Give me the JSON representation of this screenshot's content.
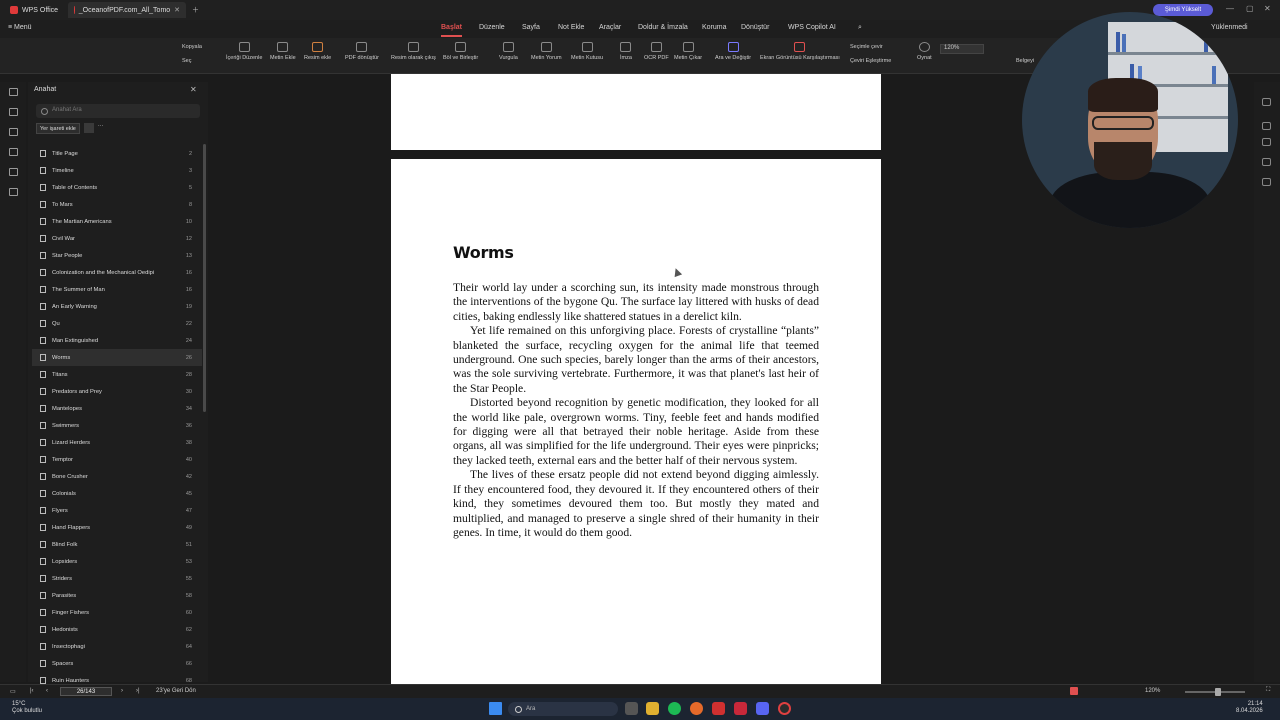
{
  "titlebar": {
    "app_tab": "WPS Office",
    "doc_tab": "_OceanofPDF.com_All_Tomo",
    "upgrade_label": "Şimdi Yükselt"
  },
  "menubar": {
    "menu_label": "Menü",
    "tabs": [
      "Başlat",
      "Düzenle",
      "Sayfa",
      "Not Ekle",
      "Araçlar",
      "Doldur & İmzala",
      "Koruma",
      "Dönüştür",
      "WPS Copilot AI"
    ],
    "active_tab": "Başlat",
    "uploaded_label": "Yüklenmedi"
  },
  "ribbon": {
    "copy": "Kopyala",
    "select": "Seç",
    "edit_content": "İçeriği Düzenle",
    "add_text": "Metin Ekle",
    "add_image": "Resim ekle",
    "pdf_convert": "PDF dönüştür",
    "image_export": "Resim olarak çıkış",
    "split_merge": "Böl ve Birleştir",
    "highlight": "Vurgula",
    "text_comment": "Metin Yorum",
    "text_box": "Metin Kutusu",
    "sign": "İmza",
    "ocr": "OCR PDF",
    "extract_text": "Metin Çıkar",
    "find_replace": "Ara ve Değiştir",
    "screenshot_compare": "Ekran Görüntüsü Karşılaştırması",
    "select_translate": "Seçimle çevir",
    "translate_match": "Çeviri Eşleştirme",
    "play": "Oynat",
    "doc": "Belgeyi",
    "zoom": "120%"
  },
  "sidebar": {
    "title": "Anahat",
    "search_placeholder": "Anahat Ara",
    "add_bookmark": "Yer işareti ekle",
    "items": [
      {
        "label": "Title Page",
        "page": "2"
      },
      {
        "label": "Timeline",
        "page": "3"
      },
      {
        "label": "Table of Contents",
        "page": "5"
      },
      {
        "label": "To Mars",
        "page": "8"
      },
      {
        "label": "The Martian Americans",
        "page": "10"
      },
      {
        "label": "Civil War",
        "page": "12"
      },
      {
        "label": "Star People",
        "page": "13"
      },
      {
        "label": "Colonization and the Mechanical Oedipi",
        "page": "16"
      },
      {
        "label": "The Summer of Man",
        "page": "16"
      },
      {
        "label": "An Early Warning",
        "page": "19"
      },
      {
        "label": "Qu",
        "page": "22"
      },
      {
        "label": "Man Extinguished",
        "page": "24"
      },
      {
        "label": "Worms",
        "page": "26"
      },
      {
        "label": "Titans",
        "page": "28"
      },
      {
        "label": "Predators and Prey",
        "page": "30"
      },
      {
        "label": "Mantelopes",
        "page": "34"
      },
      {
        "label": "Swimmers",
        "page": "36"
      },
      {
        "label": "Lizard Herders",
        "page": "38"
      },
      {
        "label": "Temptor",
        "page": "40"
      },
      {
        "label": "Bone Crusher",
        "page": "42"
      },
      {
        "label": "Colonials",
        "page": "45"
      },
      {
        "label": "Flyers",
        "page": "47"
      },
      {
        "label": "Hand Flappers",
        "page": "49"
      },
      {
        "label": "Blind Folk",
        "page": "51"
      },
      {
        "label": "Lopsiders",
        "page": "53"
      },
      {
        "label": "Striders",
        "page": "55"
      },
      {
        "label": "Parasites",
        "page": "58"
      },
      {
        "label": "Finger Fishers",
        "page": "60"
      },
      {
        "label": "Hedonists",
        "page": "62"
      },
      {
        "label": "Insectophagi",
        "page": "64"
      },
      {
        "label": "Spacers",
        "page": "66"
      },
      {
        "label": "Ruin Haunters",
        "page": "68"
      }
    ],
    "selected_label": "Worms"
  },
  "document": {
    "title": "Worms",
    "paragraphs": [
      "Their world lay under a scorching sun, its intensity made monstrous through the interventions of the bygone Qu. The surface lay littered with husks of dead cities, baking endlessly like shattered statues in a derelict kiln.",
      "Yet life remained on this unforgiving place. Forests of crystalline “plants” blanketed the surface, recycling oxygen for the animal life that teemed underground. One such species, barely longer than the arms of their ancestors, was the sole surviving vertebrate. Furthermore, it was that planet's last heir of the Star People.",
      "Distorted beyond recognition by genetic modification, they looked for all the world like pale, overgrown worms. Tiny, feeble feet and hands modified for digging were all that betrayed their noble heritage. Aside from these organs, all was simplified for the life underground. Their eyes were pinpricks; they lacked teeth, external ears and the better half of their nervous system.",
      "The lives of these ersatz people did not extend beyond digging aimlessly. If they encountered food, they devoured it. If they encountered others of their kind, they sometimes devoured them too. But mostly they mated and multiplied, and managed to preserve a single shred of their humanity in their genes. In time, it would do them good."
    ]
  },
  "statusbar": {
    "page_indicator": "26/143",
    "back_label": "23'ye Geri Dön",
    "zoom": "120%"
  },
  "taskbar": {
    "temperature": "15°C",
    "weather": "Çok bulutlu",
    "search_label": "Ara",
    "time": "21:14",
    "date": "8.04.2026"
  }
}
